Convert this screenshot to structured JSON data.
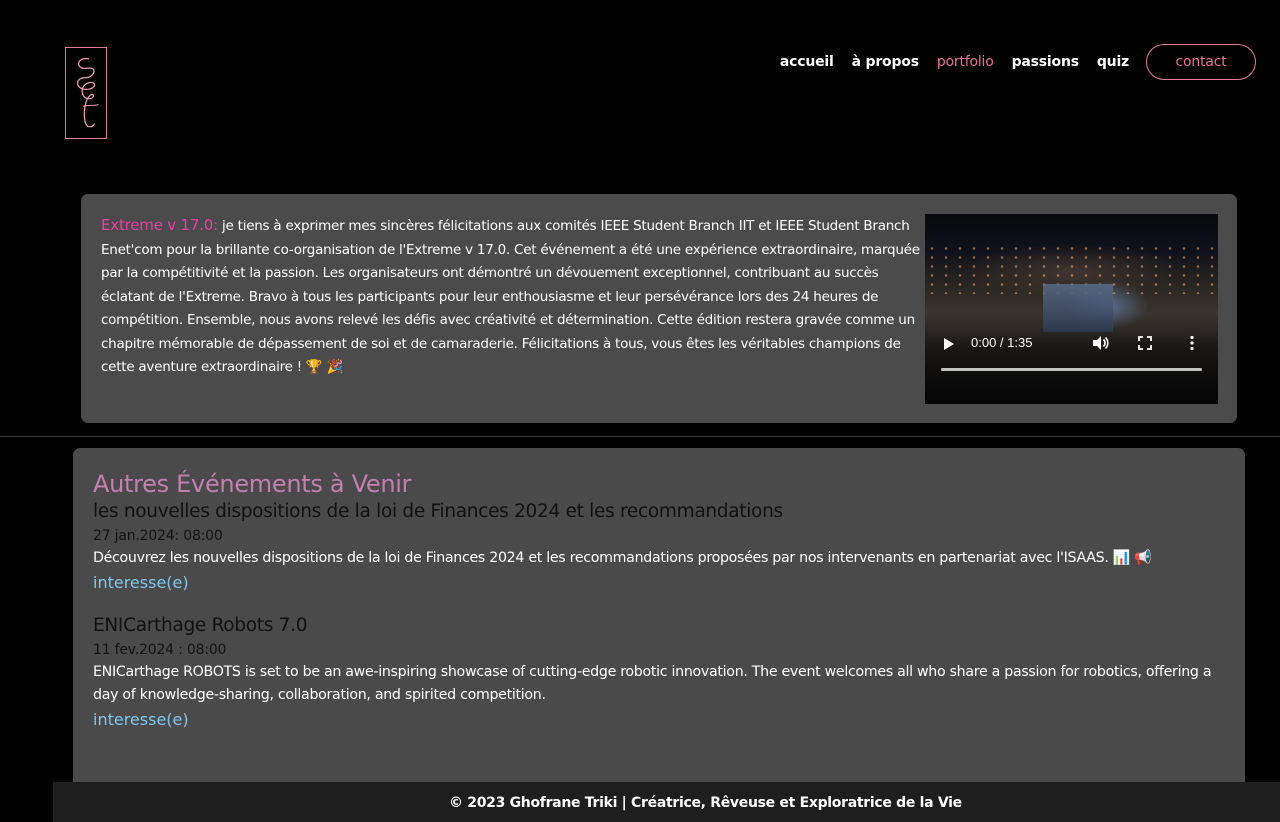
{
  "nav": {
    "items": [
      {
        "label": "accueil"
      },
      {
        "label": "à propos"
      },
      {
        "label": "portfolio"
      },
      {
        "label": "passions"
      },
      {
        "label": "quiz"
      }
    ],
    "active_item": "portfolio",
    "contact_label": "contact"
  },
  "featured": {
    "highlight": "Extreme v 17.0:",
    "text": " je tiens à exprimer mes sincères félicitations aux comités IEEE Student Branch IIT et IEEE Student Branch Enet'com pour la brillante co-organisation de l'Extreme v 17.0. Cet événement a été une expérience extraordinaire, marquée par la compétitivité et la passion. Les organisateurs ont démontré un dévouement exceptionnel, contribuant au succès éclatant de l'Extreme. Bravo à tous les participants pour leur enthousiasme et leur persévérance lors des 24 heures de compétition. Ensemble, nous avons relevé les défis avec créativité et détermination. Cette édition restera gravée comme un chapitre mémorable de dépassement de soi et de camaraderie. Félicitations à tous, vous êtes les véritables champions de cette aventure extraordinaire ! 🏆 🎉",
    "video": {
      "time": "0:00 / 1:35",
      "progress": 0
    }
  },
  "events": {
    "heading": "Autres Événements à Venir",
    "items": [
      {
        "title": "les nouvelles dispositions de la loi de Finances 2024 et les recommandations",
        "date": "27 jan.2024: 08:00",
        "description": "Découvrez les nouvelles dispositions de la loi de Finances 2024 et les recommandations proposées par nos intervenants en partenariat avec l'ISAAS. 📊 📢",
        "interest_label": "interesse(e)"
      },
      {
        "title": "ENICarthage Robots 7.0",
        "date": "11 fev.2024 : 08:00",
        "description": "ENICarthage ROBOTS is set to be an awe-inspiring showcase of cutting-edge robotic innovation. The event welcomes all who share a passion for robotics, offering a day of knowledge-sharing, collaboration, and spirited competition.",
        "interest_label": "interesse(e)"
      }
    ]
  },
  "footer": {
    "copyright": "© 2023 Ghofrane Triki | Créatrice, Rêveuse et Exploratrice de la Vie"
  },
  "colors": {
    "background": "#000000",
    "accent_pink": "#ec6f9c",
    "highlight_magenta": "#e83fa7",
    "panel": "#4b4b4b",
    "heading_mauve": "#c27fb0",
    "link_blue": "#7ec7ef"
  },
  "icons": [
    "logo-monogram-icon",
    "play-icon",
    "volume-icon",
    "fullscreen-icon",
    "more-options-icon"
  ]
}
